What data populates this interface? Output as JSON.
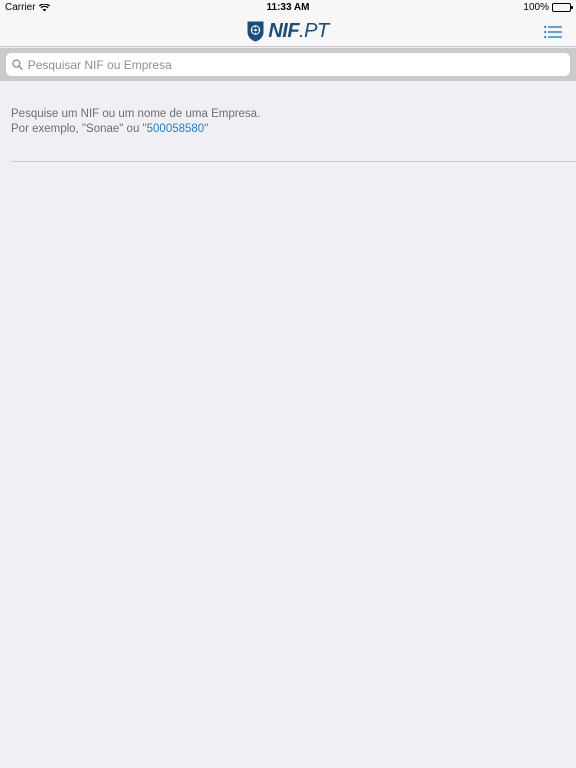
{
  "status_bar": {
    "carrier": "Carrier",
    "time": "11:33 AM",
    "battery_percent": "100%",
    "battery_level": 1.0
  },
  "nav": {
    "logo_nif": "NIF",
    "logo_pt": ".PT",
    "brand_color": "#1b4e7c",
    "menu_icon": "list-icon",
    "accent_color": "#1f7fd0"
  },
  "search": {
    "placeholder": "Pesquisar NIF ou Empresa",
    "value": ""
  },
  "hint": {
    "line1": "Pesquise um NIF ou um nome de uma Empresa.",
    "line2_prefix": "Por exemplo, \"Sonae\" ou \"",
    "example_nif": "500058580",
    "line2_suffix": "\""
  }
}
